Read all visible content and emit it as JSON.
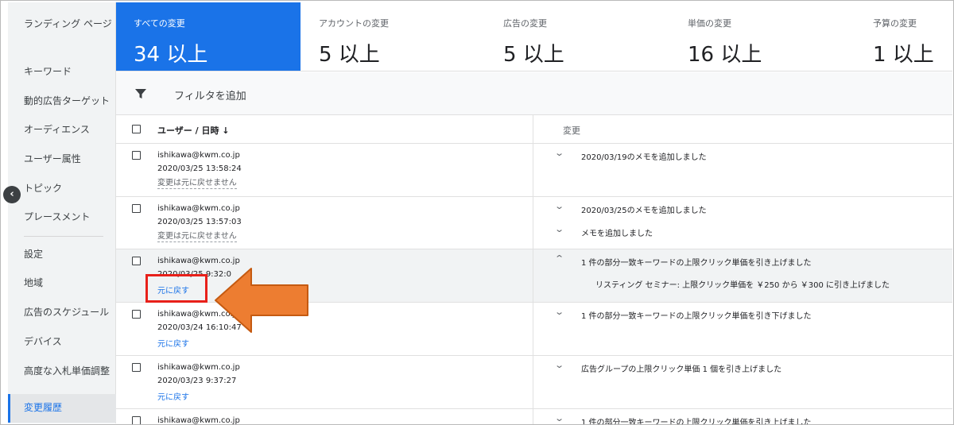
{
  "sidebar": {
    "items": [
      {
        "label": "ランディング ページ"
      },
      {
        "label": "キーワード"
      },
      {
        "label": "動的広告ターゲット"
      },
      {
        "label": "オーディエンス"
      },
      {
        "label": "ユーザー属性"
      },
      {
        "label": "トピック"
      },
      {
        "label": "プレースメント"
      },
      {
        "label": "設定"
      },
      {
        "label": "地域"
      },
      {
        "label": "広告のスケジュール"
      },
      {
        "label": "デバイス"
      },
      {
        "label": "高度な入札単価調整"
      },
      {
        "label": "変更履歴"
      }
    ],
    "active_item": "変更履歴"
  },
  "summary_cards": [
    {
      "title": "すべての変更",
      "value": "34 以上"
    },
    {
      "title": "アカウントの変更",
      "value": "5 以上"
    },
    {
      "title": "広告の変更",
      "value": "5 以上"
    },
    {
      "title": "単価の変更",
      "value": "16 以上"
    },
    {
      "title": "予算の変更",
      "value": "1 以上"
    }
  ],
  "filter": {
    "label": "フィルタを追加",
    "icon": "filter-icon"
  },
  "table": {
    "headers": {
      "user": "ユーザー / 日時 ↓",
      "change": "変更"
    },
    "rows": [
      {
        "email": "ishikawa@kwm.co.jp",
        "date": "2020/03/25 13:58:24",
        "action": "変更は元に戻せません",
        "changes": [
          "2020/03/19のメモを追加しました"
        ]
      },
      {
        "email": "ishikawa@kwm.co.jp",
        "date": "2020/03/25 13:57:03",
        "action": "変更は元に戻せません",
        "changes": [
          "2020/03/25のメモを追加しました",
          "メモを追加しました"
        ]
      },
      {
        "email": "ishikawa@kwm.co.jp",
        "date": "2020/03/25 9:32:0",
        "action": "元に戻す",
        "changes": [
          "1 件の部分一致キーワードの上限クリック単価を引き上げました"
        ],
        "detail": "リスティング セミナー: 上限クリック単価を ￥250 から ￥300 に引き上げました"
      },
      {
        "email": "ishikawa@kwm.co.jp",
        "date": "2020/03/24 16:10:47",
        "action": "元に戻す",
        "changes": [
          "1 件の部分一致キーワードの上限クリック単価を引き下げました"
        ]
      },
      {
        "email": "ishikawa@kwm.co.jp",
        "date": "2020/03/23 9:37:27",
        "action": "元に戻す",
        "changes": [
          "広告グループの上限クリック単価 1 個を引き上げました"
        ]
      },
      {
        "email": "ishikawa@kwm.co.jp",
        "changes": [
          "1 件の部分一致キーワードの上限クリック単価を引き上げました"
        ]
      }
    ]
  },
  "colors": {
    "accent": "#1a73e8",
    "highlight_box": "#e8201a",
    "arrow": "#ed7d31"
  }
}
